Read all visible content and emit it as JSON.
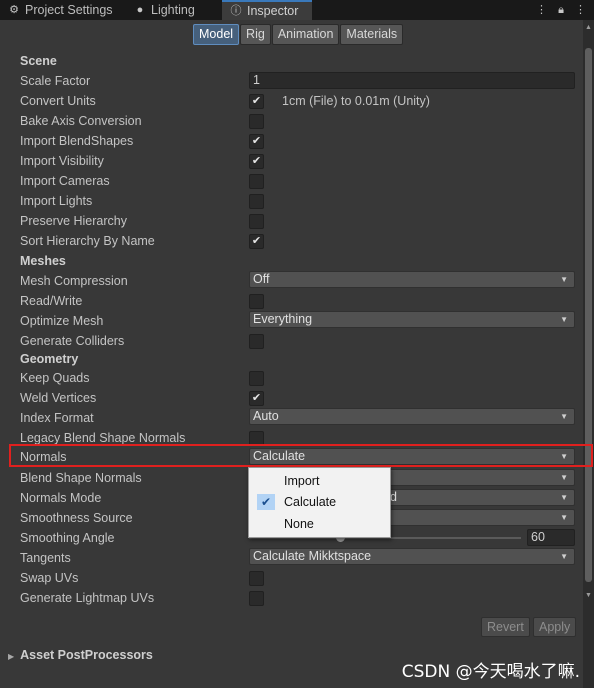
{
  "tabs": [
    {
      "label": "Project Settings",
      "icon": "gear-icon"
    },
    {
      "label": "Lighting",
      "icon": "lightbulb-icon"
    },
    {
      "label": "Inspector",
      "icon": "info-icon"
    }
  ],
  "tab_icons": [
    "more-icon",
    "lock-icon",
    "menu-icon"
  ],
  "subtabs": [
    "Model",
    "Rig",
    "Animation",
    "Materials"
  ],
  "scene": {
    "title": "Scene",
    "scale_factor_label": "Scale Factor",
    "scale_factor_value": "1",
    "convert_units_label": "Convert Units",
    "convert_units_checked": true,
    "convert_units_note": "1cm (File) to 0.01m (Unity)",
    "bake_axis_label": "Bake Axis Conversion",
    "bake_axis_checked": false,
    "blendshapes_label": "Import BlendShapes",
    "blendshapes_checked": true,
    "visibility_label": "Import Visibility",
    "visibility_checked": true,
    "cameras_label": "Import Cameras",
    "cameras_checked": false,
    "lights_label": "Import Lights",
    "lights_checked": false,
    "preserve_label": "Preserve Hierarchy",
    "preserve_checked": false,
    "sort_label": "Sort Hierarchy By Name",
    "sort_checked": true
  },
  "meshes": {
    "title": "Meshes",
    "compression_label": "Mesh Compression",
    "compression_value": "Off",
    "readwrite_label": "Read/Write",
    "readwrite_checked": false,
    "optimize_label": "Optimize Mesh",
    "optimize_value": "Everything",
    "colliders_label": "Generate Colliders",
    "colliders_checked": false
  },
  "geometry": {
    "title": "Geometry",
    "keep_quads_label": "Keep Quads",
    "keep_quads_checked": false,
    "weld_label": "Weld Vertices",
    "weld_checked": true,
    "index_label": "Index Format",
    "index_value": "Auto",
    "legacy_label": "Legacy Blend Shape Normals",
    "legacy_checked": false,
    "normals_label": "Normals",
    "normals_value": "Calculate",
    "blend_normals_label": "Blend Shape Normals",
    "normals_mode_label": "Normals Mode",
    "normals_mode_partial": "d",
    "smoothness_label": "Smoothness Source",
    "smoothing_angle_label": "Smoothing Angle",
    "smoothing_angle_value": "60",
    "smoothing_angle_max": 180,
    "tangents_label": "Tangents",
    "tangents_value": "Calculate Mikktspace",
    "swap_uvs_label": "Swap UVs",
    "swap_uvs_checked": false,
    "lightmap_label": "Generate Lightmap UVs",
    "lightmap_checked": false
  },
  "normals_popup": {
    "options": [
      "Import",
      "Calculate",
      "None"
    ],
    "selected": "Calculate"
  },
  "buttons": {
    "revert": "Revert",
    "apply": "Apply"
  },
  "asset_postprocessors": "Asset PostProcessors",
  "watermark": "CSDN @今天喝水了嘛.",
  "colors": {
    "highlight": "#e0201e",
    "accent": "#3a79bb"
  }
}
